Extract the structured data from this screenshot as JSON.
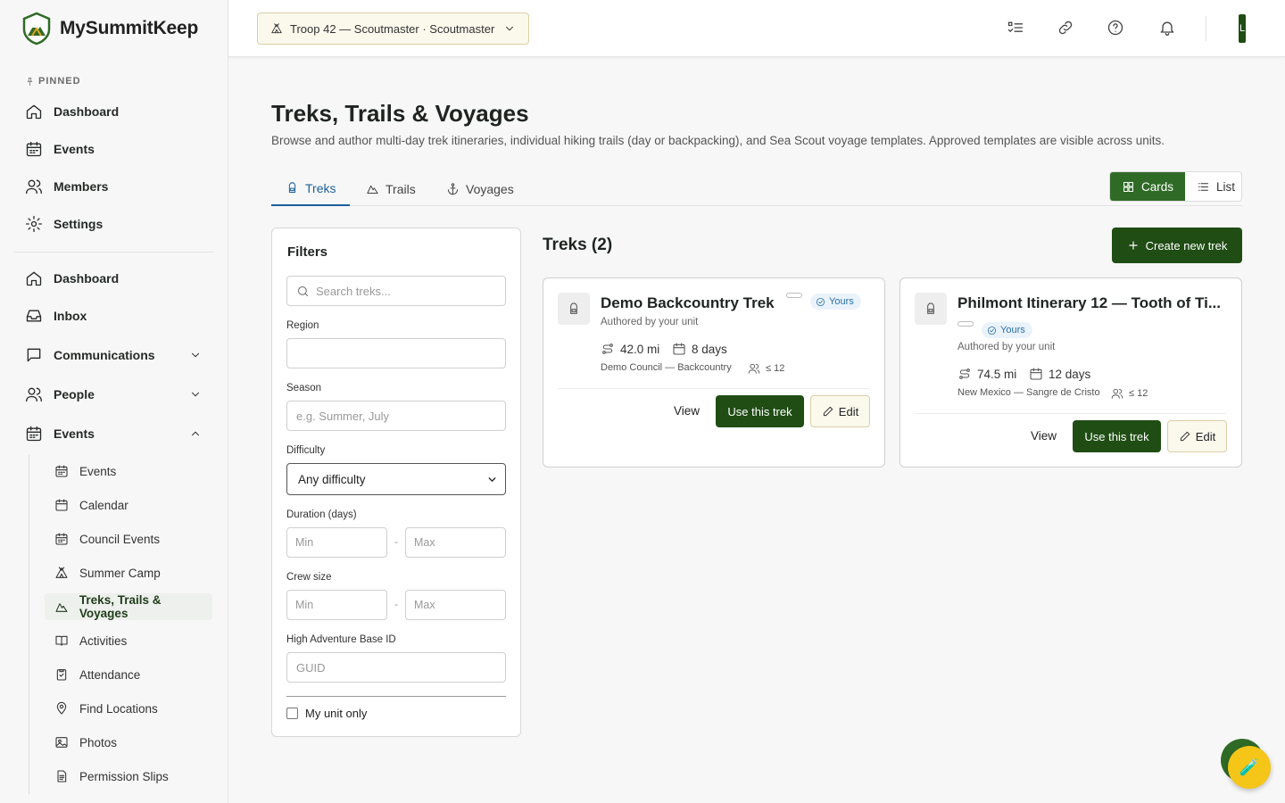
{
  "brand": {
    "name": "MySummitKeep"
  },
  "sidebar": {
    "pinned_label": "PINNED",
    "pinned": [
      {
        "label": "Dashboard",
        "icon": "home-icon"
      },
      {
        "label": "Events",
        "icon": "calendar-icon"
      },
      {
        "label": "Members",
        "icon": "users-icon"
      },
      {
        "label": "Settings",
        "icon": "gear-icon"
      }
    ],
    "main": [
      {
        "label": "Dashboard",
        "icon": "home-icon"
      },
      {
        "label": "Inbox",
        "icon": "inbox-icon"
      },
      {
        "label": "Communications",
        "icon": "message-icon",
        "expandable": true,
        "expanded": false
      },
      {
        "label": "People",
        "icon": "users-icon",
        "expandable": true,
        "expanded": false
      },
      {
        "label": "Events",
        "icon": "calendar-icon",
        "expandable": true,
        "expanded": true
      }
    ],
    "sub": [
      {
        "label": "Events",
        "icon": "calendar-grid-icon"
      },
      {
        "label": "Calendar",
        "icon": "calendar-icon"
      },
      {
        "label": "Council Events",
        "icon": "calendar-grid-icon"
      },
      {
        "label": "Summer Camp",
        "icon": "tent-icon"
      },
      {
        "label": "Treks, Trails & Voyages",
        "icon": "mountain-icon",
        "active": true
      },
      {
        "label": "Activities",
        "icon": "book-icon"
      },
      {
        "label": "Attendance",
        "icon": "clipboard-icon"
      },
      {
        "label": "Find Locations",
        "icon": "map-pin-icon"
      },
      {
        "label": "Photos",
        "icon": "image-icon"
      },
      {
        "label": "Permission Slips",
        "icon": "document-icon"
      }
    ]
  },
  "topbar": {
    "unit_selector": "Troop 42 — Scoutmaster · Scoutmaster",
    "avatar_initial": "L"
  },
  "page": {
    "title": "Treks, Trails & Voyages",
    "description": "Browse and author multi-day trek itineraries, individual hiking trails (day or backpacking), and Sea Scout voyage templates. Approved templates are visible across units."
  },
  "tabs": [
    {
      "label": "Treks",
      "icon": "backpack-icon",
      "active": true
    },
    {
      "label": "Trails",
      "icon": "mountain-icon"
    },
    {
      "label": "Voyages",
      "icon": "anchor-icon"
    }
  ],
  "view_toggle": {
    "cards": "Cards",
    "list": "List",
    "selected": "Cards"
  },
  "filters": {
    "title": "Filters",
    "search_placeholder": "Search treks...",
    "region_label": "Region",
    "region_value": "",
    "season_label": "Season",
    "season_placeholder": "e.g. Summer, July",
    "difficulty_label": "Difficulty",
    "difficulty_value": "Any difficulty",
    "duration_label": "Duration (days)",
    "crew_label": "Crew size",
    "min_placeholder": "Min",
    "max_placeholder": "Max",
    "range_sep": "-",
    "hab_label": "High Adventure Base ID",
    "hab_placeholder": "GUID",
    "my_unit_label": "My unit only"
  },
  "results": {
    "title": "Treks (2)",
    "create_label": "Create new trek",
    "view_label": "View",
    "use_label": "Use this trek",
    "edit_label": "Edit",
    "cards": [
      {
        "title": "Demo Backcountry Trek",
        "badge": "Yours",
        "authored": "Authored by your unit",
        "distance": "42.0 mi",
        "duration": "8 days",
        "location": "Demo Council — Backcountry",
        "crew": "≤ 12"
      },
      {
        "title": "Philmont Itinerary 12 — Tooth of Ti...",
        "badge": "Yours",
        "authored": "Authored by your unit",
        "distance": "74.5 mi",
        "duration": "12 days",
        "location": "New Mexico — Sangre de Cristo",
        "crew": "≤ 12"
      }
    ]
  },
  "fab": {
    "icon": "test-tube-icon",
    "glyph": "🧪"
  },
  "colors": {
    "brand_green": "#1f4d14",
    "accent_blue": "#1e5f9a",
    "fab_yellow": "#f5c518"
  }
}
